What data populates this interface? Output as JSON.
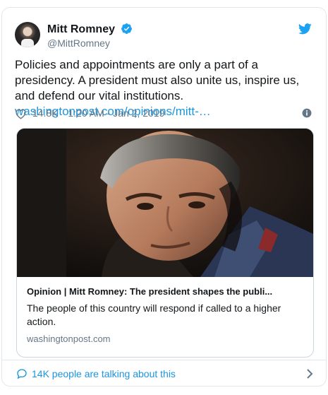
{
  "tweet": {
    "author": {
      "name": "Mitt Romney",
      "handle": "@MittRomney"
    },
    "text": "Policies and appointments are only a part of a presidency. A president must also unite us, inspire us, and defend our vital institutions.",
    "link_text": "washingtonpost.com/opinions/mitt-…",
    "likes": "14.8K",
    "timestamp": "1:20 AM - Jan 2, 2019"
  },
  "card": {
    "title": "Opinion | Mitt Romney: The president shapes the publi...",
    "description": "The people of this country will respond if called to a higher action.",
    "domain": "washingtonpost.com"
  },
  "footer": {
    "talking_label": "14K people are talking about this"
  },
  "colors": {
    "twitter_blue": "#1da1f2",
    "link_blue": "#1b95e0",
    "muted": "#657786",
    "border": "#e1e8ed"
  },
  "icons": {
    "verified": "verified-badge-icon",
    "brand": "twitter-bird-icon",
    "like": "heart-icon",
    "info": "info-icon",
    "reply": "speech-bubble-icon",
    "more": "chevron-right-icon"
  }
}
